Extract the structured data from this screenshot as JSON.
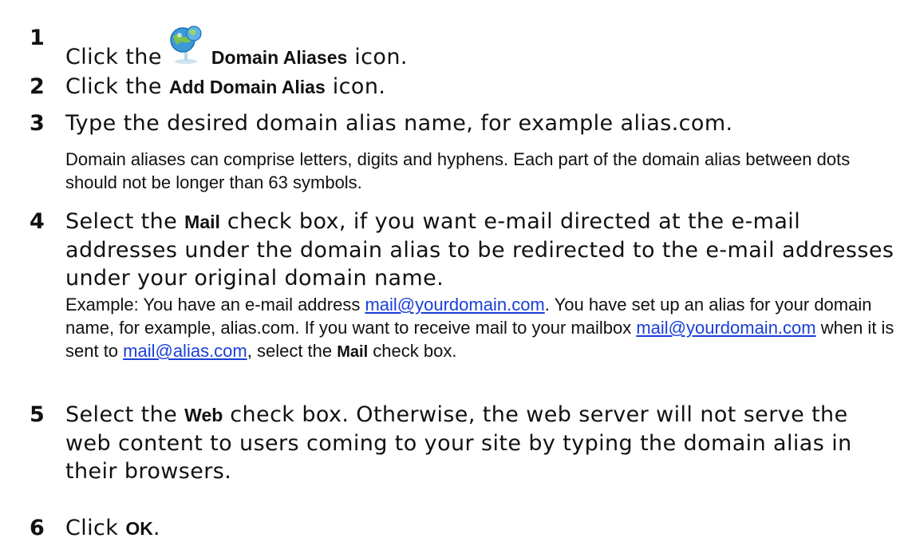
{
  "steps": [
    {
      "number": "1",
      "before": "Click the",
      "icon": "domain-aliases-globe-icon",
      "ui_label": "Domain Aliases",
      "after": " icon."
    },
    {
      "number": "2",
      "before": "Click the ",
      "ui_label": "Add Domain Alias",
      "after": " icon."
    },
    {
      "number": "3",
      "text": "Type the desired domain alias name, for example alias.com.",
      "note": "Domain aliases can comprise letters, digits and hyphens. Each part of the domain alias between dots should not be longer than 63 symbols."
    },
    {
      "number": "4",
      "before": "Select the ",
      "ui_label": "Mail",
      "after": " check box, if you want e-mail directed at the e-mail addresses under the domain alias to be redirected to the e-mail addresses under your original domain name.",
      "note": {
        "part1": "Example: You have an e-mail address ",
        "link1": "mail@yourdomain.com",
        "part2": ". You have set up an alias for your domain name, for example, alias.com. If you want to receive mail to your mailbox ",
        "link2": "mail@yourdomain.com",
        "part3": " when it is sent to ",
        "link3": "mail@alias.com",
        "part4": ", select the ",
        "ui_label": "Mail",
        "part5": " check box."
      }
    },
    {
      "number": "5",
      "before": "Select the ",
      "ui_label": "Web",
      "after": " check box. Otherwise, the web server will not serve the web content to users coming to your site by typing the domain alias in their browsers."
    },
    {
      "number": "6",
      "before": "Click ",
      "ui_label": "OK",
      "after": "."
    }
  ],
  "colors": {
    "text": "#111111",
    "link": "#1a3fd8",
    "icon_globe": "#3a9ad9",
    "icon_green": "#7cc24e"
  }
}
